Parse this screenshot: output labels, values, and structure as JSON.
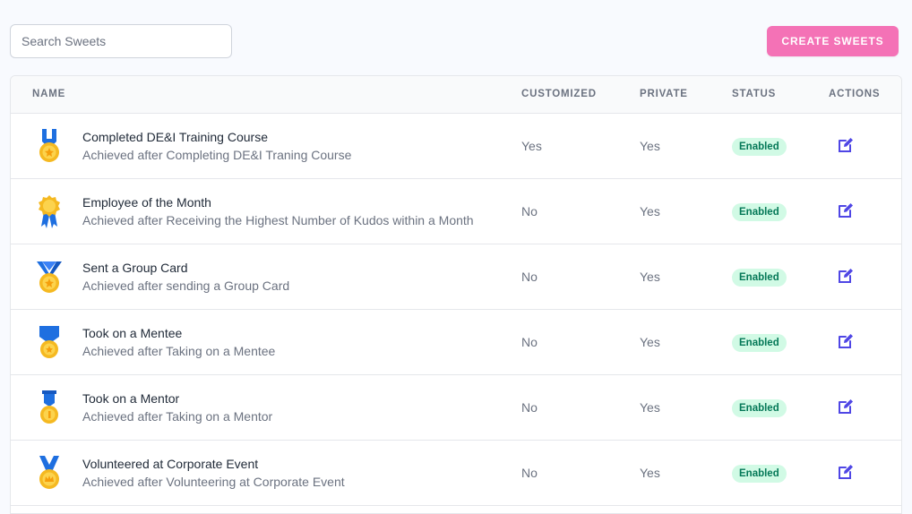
{
  "search": {
    "placeholder": "Search Sweets",
    "value": ""
  },
  "toolbar": {
    "create_label": "CREATE SWEETS"
  },
  "colors": {
    "accent_pink": "#f472b6",
    "status_bg": "#d1fae5",
    "status_text": "#047857",
    "edit_icon": "#4f46e5",
    "medal_gold": "#f5b921",
    "ribbon_blue": "#1e6fe0"
  },
  "table": {
    "columns": [
      "NAME",
      "CUSTOMIZED",
      "PRIVATE",
      "STATUS",
      "ACTIONS"
    ],
    "rows": [
      {
        "icon": "medal-icon",
        "title": "Completed DE&I Training Course",
        "subtitle": "Achieved after Completing DE&I Traning Course",
        "customized": "Yes",
        "private": "Yes",
        "status": "Enabled",
        "action_icon": "edit-icon"
      },
      {
        "icon": "medal-icon",
        "title": "Employee of the Month",
        "subtitle": "Achieved after Receiving the Highest Number of Kudos within a Month",
        "customized": "No",
        "private": "Yes",
        "status": "Enabled",
        "action_icon": "edit-icon"
      },
      {
        "icon": "medal-icon",
        "title": "Sent a Group Card",
        "subtitle": "Achieved after sending a Group Card",
        "customized": "No",
        "private": "Yes",
        "status": "Enabled",
        "action_icon": "edit-icon"
      },
      {
        "icon": "medal-icon",
        "title": "Took on a Mentee",
        "subtitle": "Achieved after Taking on a Mentee",
        "customized": "No",
        "private": "Yes",
        "status": "Enabled",
        "action_icon": "edit-icon"
      },
      {
        "icon": "medal-icon",
        "title": "Took on a Mentor",
        "subtitle": "Achieved after Taking on a Mentor",
        "customized": "No",
        "private": "Yes",
        "status": "Enabled",
        "action_icon": "edit-icon"
      },
      {
        "icon": "medal-icon",
        "title": "Volunteered at Corporate Event",
        "subtitle": "Achieved after Volunteering at Corporate Event",
        "customized": "No",
        "private": "Yes",
        "status": "Enabled",
        "action_icon": "edit-icon"
      }
    ]
  }
}
